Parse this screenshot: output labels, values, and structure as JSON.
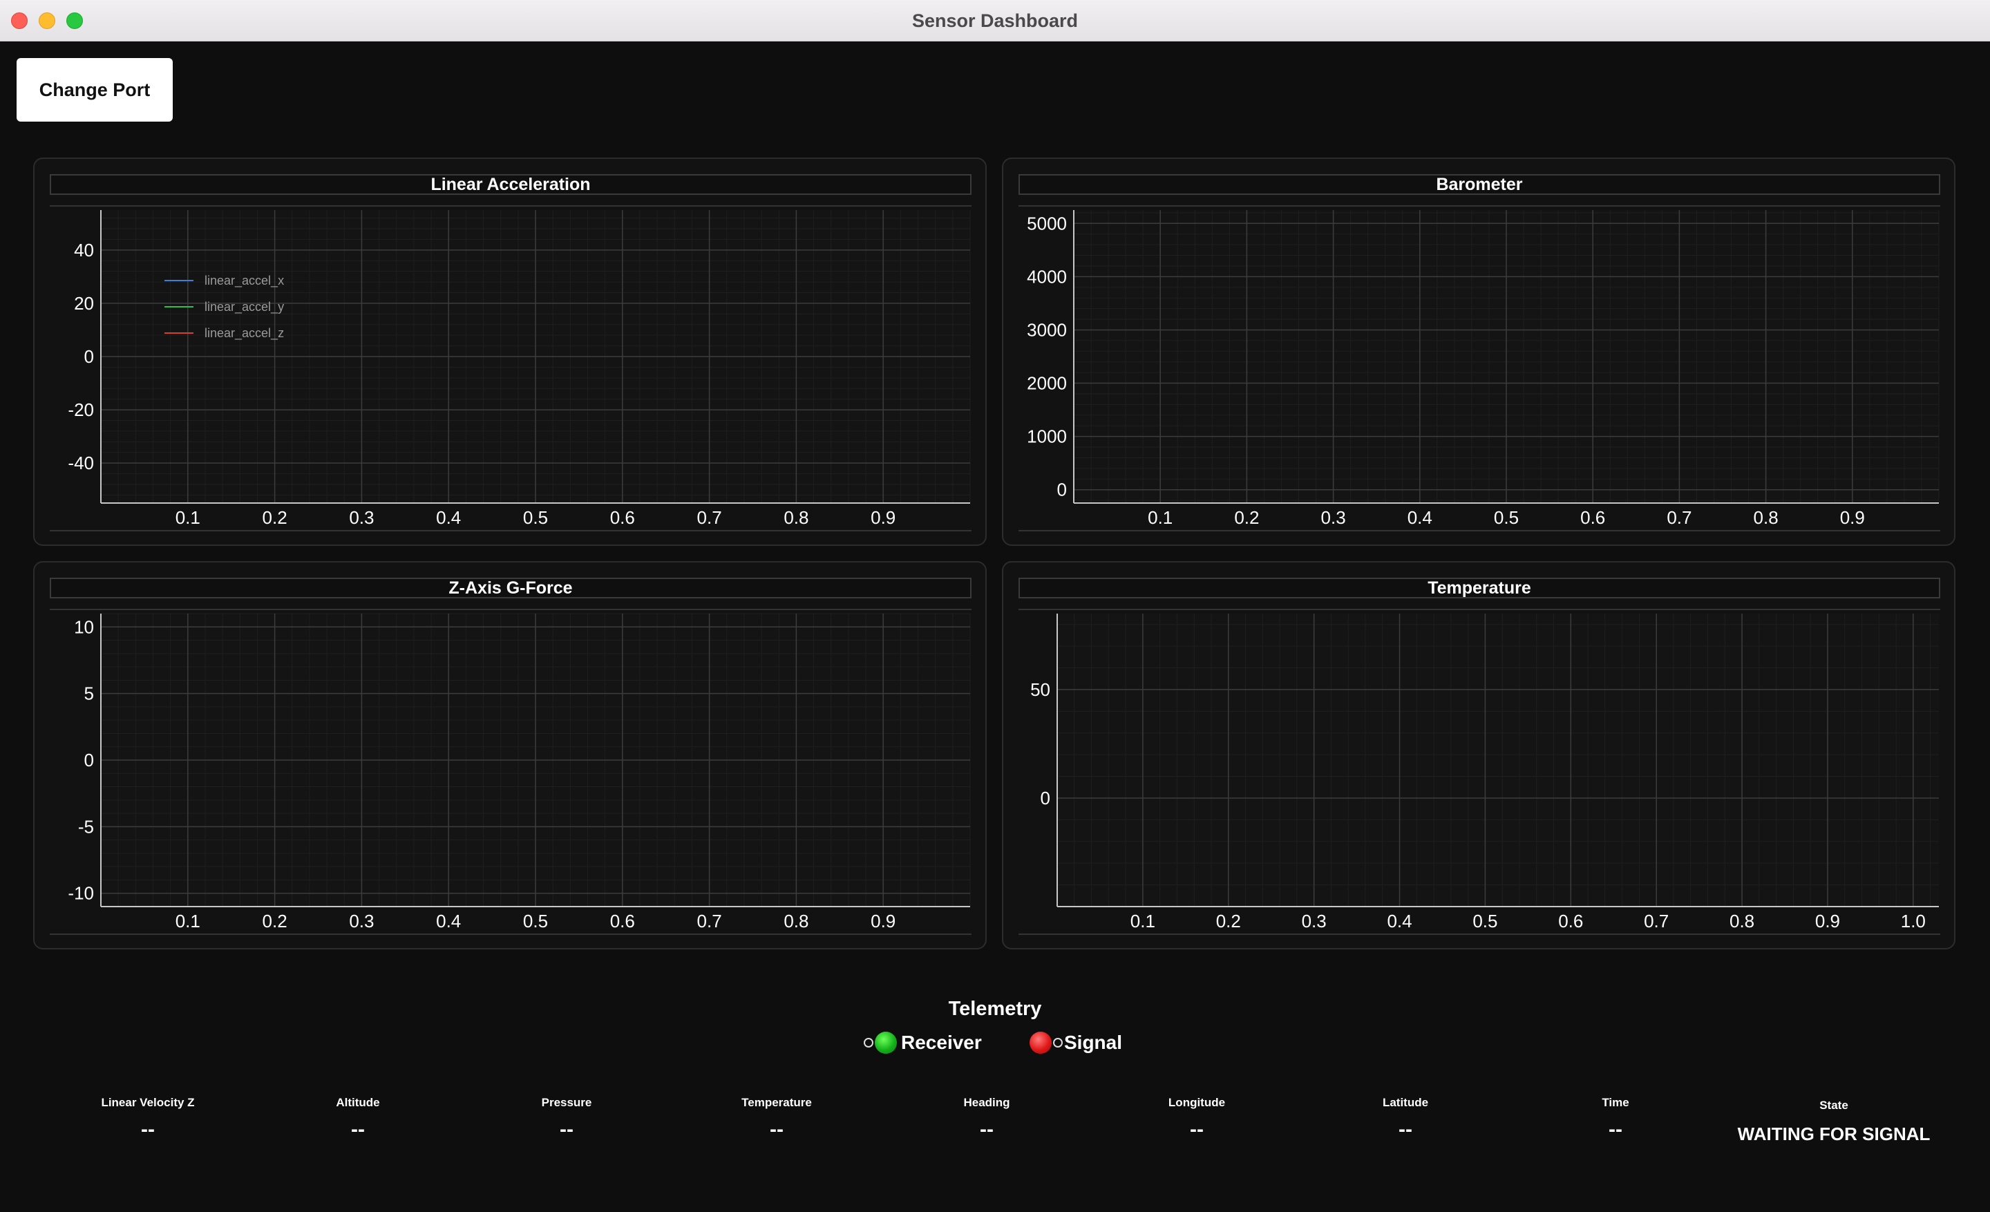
{
  "window": {
    "title": "Sensor Dashboard"
  },
  "toolbar": {
    "change_port_label": "Change Port"
  },
  "panels": [
    {
      "title": "Linear Acceleration",
      "y_ticks": [
        "40",
        "20",
        "0",
        "-20",
        "-40"
      ],
      "x_ticks": [
        "0.1",
        "0.2",
        "0.3",
        "0.4",
        "0.5",
        "0.6",
        "0.7",
        "0.8",
        "0.9"
      ],
      "legend": [
        {
          "label": "linear_accel_x",
          "color": "#3d7fd6"
        },
        {
          "label": "linear_accel_y",
          "color": "#2fbf4f"
        },
        {
          "label": "linear_accel_z",
          "color": "#d6402f"
        }
      ]
    },
    {
      "title": "Barometer",
      "y_ticks": [
        "5000",
        "4000",
        "3000",
        "2000",
        "1000",
        "0"
      ],
      "x_ticks": [
        "0.1",
        "0.2",
        "0.3",
        "0.4",
        "0.5",
        "0.6",
        "0.7",
        "0.8",
        "0.9"
      ],
      "legend": []
    },
    {
      "title": "Z-Axis G-Force",
      "y_ticks": [
        "10",
        "5",
        "0",
        "-5",
        "-10"
      ],
      "x_ticks": [
        "0.1",
        "0.2",
        "0.3",
        "0.4",
        "0.5",
        "0.6",
        "0.7",
        "0.8",
        "0.9"
      ],
      "legend": []
    },
    {
      "title": "Temperature",
      "y_ticks": [
        "50",
        "0"
      ],
      "x_ticks": [
        "0.1",
        "0.2",
        "0.3",
        "0.4",
        "0.5",
        "0.6",
        "0.7",
        "0.8",
        "0.9",
        "1.0"
      ],
      "legend": []
    }
  ],
  "chart_data": [
    {
      "type": "line",
      "title": "Linear Acceleration",
      "series": [
        {
          "name": "linear_accel_x",
          "values": []
        },
        {
          "name": "linear_accel_y",
          "values": []
        },
        {
          "name": "linear_accel_z",
          "values": []
        }
      ],
      "xlim": [
        0,
        1
      ],
      "ylim": [
        -55,
        55
      ],
      "grid": true,
      "legend": "top-left"
    },
    {
      "type": "line",
      "title": "Barometer",
      "series": [],
      "xlim": [
        0,
        1
      ],
      "ylim": [
        -250,
        5250
      ],
      "grid": true
    },
    {
      "type": "line",
      "title": "Z-Axis G-Force",
      "series": [],
      "xlim": [
        0,
        1
      ],
      "ylim": [
        -11,
        11
      ],
      "grid": true
    },
    {
      "type": "line",
      "title": "Temperature",
      "series": [],
      "xlim": [
        0,
        1.03
      ],
      "ylim": [
        -50,
        85
      ],
      "grid": true
    }
  ],
  "telemetry": {
    "title": "Telemetry",
    "receiver_label": "Receiver",
    "signal_label": "Signal",
    "receiver_color": "#1fd020",
    "signal_color": "#e01818"
  },
  "metrics": [
    {
      "label": "Linear Velocity Z",
      "value": "--"
    },
    {
      "label": "Altitude",
      "value": "--"
    },
    {
      "label": "Pressure",
      "value": "--"
    },
    {
      "label": "Temperature",
      "value": "--"
    },
    {
      "label": "Heading",
      "value": "--"
    },
    {
      "label": "Longitude",
      "value": "--"
    },
    {
      "label": "Latitude",
      "value": "--"
    },
    {
      "label": "Time",
      "value": "--"
    }
  ],
  "state": {
    "label": "State",
    "value": "WAITING FOR SIGNAL"
  }
}
